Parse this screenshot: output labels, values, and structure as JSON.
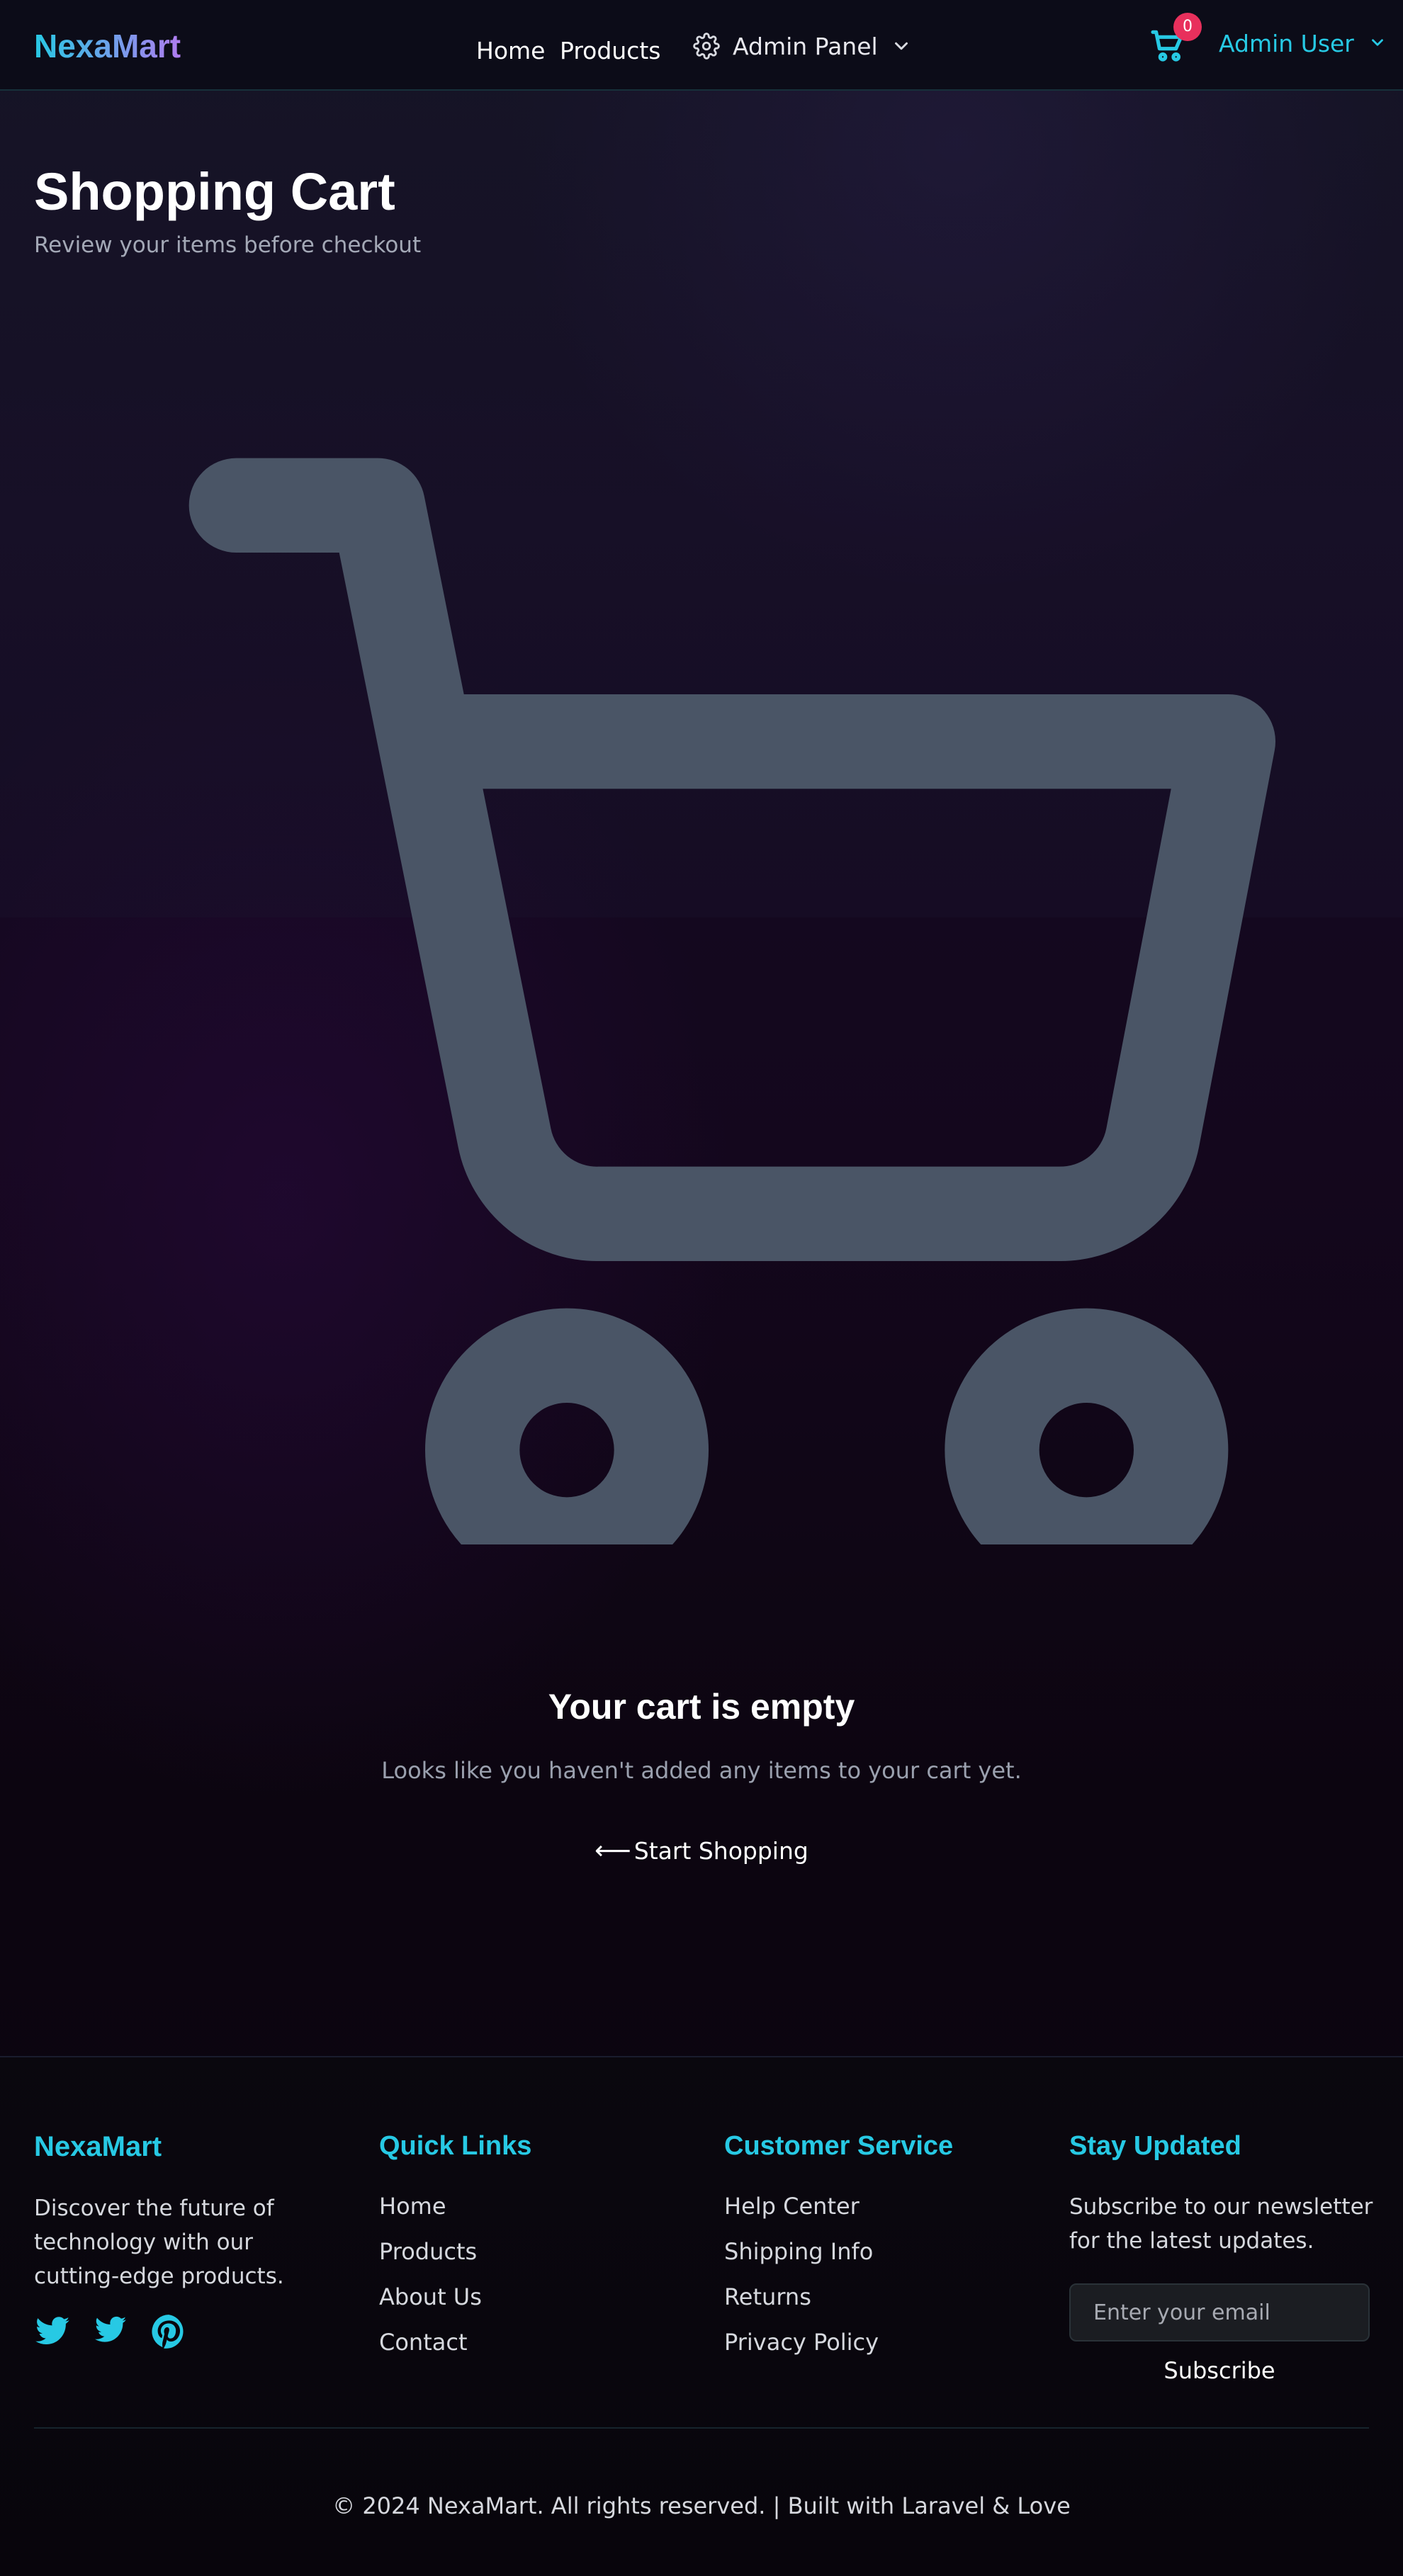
{
  "header": {
    "brand": "NexaMart",
    "nav": [
      {
        "label": "Home"
      },
      {
        "label": "Products"
      }
    ],
    "admin_panel_label": "Admin Panel",
    "cart_count": "0",
    "user_name": "Admin User"
  },
  "page": {
    "title": "Shopping Cart",
    "subtitle": "Review your items before checkout"
  },
  "empty_state": {
    "icon": "shopping-cart-icon",
    "title": "Your cart is empty",
    "message": "Looks like you haven't added any items to your cart yet.",
    "cta_arrow": "⟵",
    "cta_label": "Start Shopping"
  },
  "footer": {
    "brand": "NexaMart",
    "description": "Discover the future of technology with our cutting-edge products.",
    "social_icons": [
      "twitter-icon",
      "twitter-icon",
      "pinterest-icon"
    ],
    "quick_links": {
      "heading": "Quick Links",
      "items": [
        "Home",
        "Products",
        "About Us",
        "Contact"
      ]
    },
    "customer_service": {
      "heading": "Customer Service",
      "items": [
        "Help Center",
        "Shipping Info",
        "Returns",
        "Privacy Policy"
      ]
    },
    "newsletter": {
      "heading": "Stay Updated",
      "text": "Subscribe to our newsletter for the latest updates.",
      "placeholder": "Enter your email",
      "button": "Subscribe"
    },
    "copyright": "© 2024 NexaMart. All rights reserved. | Built with Laravel & Love"
  },
  "colors": {
    "accent": "#27c9e4",
    "badge": "#e8305c",
    "cart_icon": "#4a5566"
  }
}
